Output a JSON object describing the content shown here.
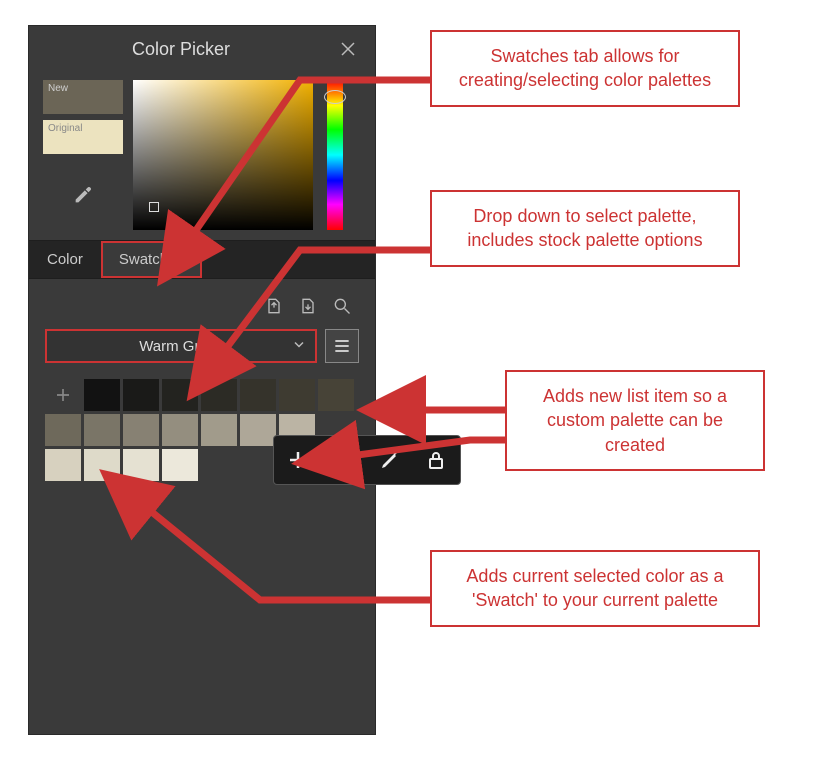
{
  "panel": {
    "title": "Color Picker",
    "new_label": "New",
    "original_label": "Original"
  },
  "tabs": {
    "color": "Color",
    "swatches": "Swatches"
  },
  "palette": {
    "selected": "Warm Grays",
    "rows": [
      [
        "#121212",
        "#1a1a18",
        "#23231f",
        "#2c2b25",
        "#35332b",
        "#3e3b31",
        "#474337"
      ],
      [
        "#6e695b",
        "#7a7567",
        "#878173",
        "#948e7f",
        "#a19b8b",
        "#aea798",
        "#bbb4a4"
      ],
      [
        "#d7d1bf",
        "#dedac9",
        "#e5e1d2",
        "#ece8db"
      ]
    ]
  },
  "callouts": {
    "c1": "Swatches tab allows for creating/selecting color palettes",
    "c2": "Drop down to select palette, includes stock palette options",
    "c3": "Adds new list item so a custom palette can be created",
    "c4": "Adds current selected color as a 'Swatch' to your current palette"
  }
}
